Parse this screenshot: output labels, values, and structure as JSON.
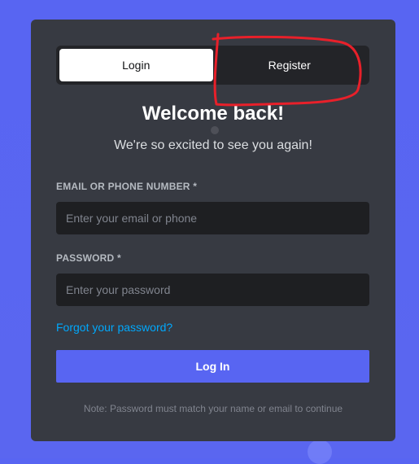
{
  "tabs": [
    {
      "label": "Login",
      "active": true
    },
    {
      "label": "Register",
      "active": false
    }
  ],
  "heading": "Welcome back!",
  "subheading": "We're so excited to see you again!",
  "email": {
    "label": "EMAIL OR PHONE NUMBER",
    "required_mark": "*",
    "placeholder": "Enter your email or phone",
    "value": ""
  },
  "password": {
    "label": "PASSWORD",
    "required_mark": "*",
    "placeholder": "Enter your password",
    "value": ""
  },
  "forgot_password": "Forgot your password?",
  "login_button": "Log In",
  "note": "Note: Password must match your name or email to continue",
  "colors": {
    "background": "#5865f2",
    "card": "#373a42",
    "accent": "#5865f2",
    "link": "#00a8fc",
    "annotation": "#e8202a"
  }
}
